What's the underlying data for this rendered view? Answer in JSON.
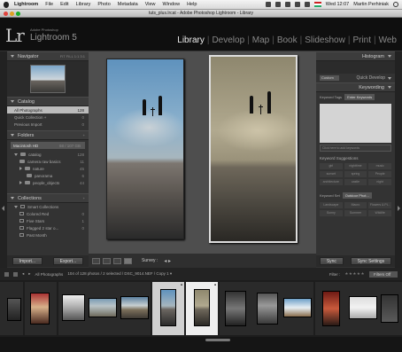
{
  "menubar": {
    "app": "Lightroom",
    "items": [
      "File",
      "Edit",
      "Library",
      "Photo",
      "Metadata",
      "View",
      "Window",
      "Help"
    ],
    "clock": "Wed 12:07",
    "user": "Martin Perhiniak"
  },
  "window": {
    "title": "tuts_plus.lrcat - Adobe Photoshop Lightroom - Library"
  },
  "identity": {
    "mark": "Lr",
    "small": "Adobe Photoshop",
    "name": "Lightroom 5"
  },
  "modules": [
    "Library",
    "Develop",
    "Map",
    "Book",
    "Slideshow",
    "Print",
    "Web"
  ],
  "active_module": "Library",
  "left_panel": {
    "navigator": {
      "title": "Navigator",
      "zoom_opts": "FIT  FILL  1:1  3:1"
    },
    "catalog": {
      "title": "Catalog",
      "items": [
        {
          "label": "All Photographs",
          "count": "128"
        },
        {
          "label": "Quick Collection +",
          "count": "0"
        },
        {
          "label": "Previous Import",
          "count": "0"
        }
      ]
    },
    "folders": {
      "title": "Folders",
      "drive": {
        "label": "Macintosh HD",
        "count": "68 / 107 GB"
      },
      "items": [
        {
          "label": "catalog",
          "count": "128"
        },
        {
          "label": "camera raw basics",
          "count": "11"
        },
        {
          "label": "nature",
          "count": "45"
        },
        {
          "label": "panorama",
          "count": "6"
        },
        {
          "label": "people_objects",
          "count": "44"
        }
      ]
    },
    "collections": {
      "title": "Collections",
      "items": [
        {
          "label": "Smart Collections",
          "count": ""
        },
        {
          "label": "Colored Red",
          "count": "0"
        },
        {
          "label": "Five Stars",
          "count": "1"
        },
        {
          "label": "Flagged 2 star o...",
          "count": "0"
        },
        {
          "label": "Past Month",
          "count": ""
        }
      ]
    },
    "buttons": {
      "import": "Import...",
      "export": "Export..."
    }
  },
  "right_panel": {
    "histogram": "Histogram",
    "quick_develop": {
      "preset": "Custom",
      "title": "Quick Develop"
    },
    "keywording": {
      "title": "Keywording",
      "tags_label": "Keyword Tags",
      "tags_select": "Enter Keywords",
      "input_placeholder": "Click here to add keywords",
      "suggestions_title": "Keyword Suggestions",
      "suggestions": [
        "girl",
        "nighttime",
        "music",
        "sunset",
        "spring",
        "People",
        "architecture",
        "castle",
        "night"
      ],
      "set_label": "Keyword Set",
      "set_select": "Outdoor Phot...",
      "set_keywords": [
        "Landscape",
        "Macro",
        "Flowers & Pl...",
        "Sunny",
        "Summer",
        "Wildlife"
      ]
    },
    "buttons": {
      "sync": "Sync",
      "sync_settings": "Sync Settings"
    }
  },
  "toolbar": {
    "survey": "Survey :",
    "arrows": "◂ ▸"
  },
  "filmstrip": {
    "source": "All Photographs",
    "status": "104 of 128 photos / 2 selected / DSC_9014.NEF / Copy 1 ▾",
    "filter_label": "Filter :",
    "filter_value": "Filters Off",
    "stars": "★★★★★"
  },
  "colors": {
    "accent": "#eeeeee",
    "panel": "#333333",
    "background": "#4e4e4e"
  }
}
